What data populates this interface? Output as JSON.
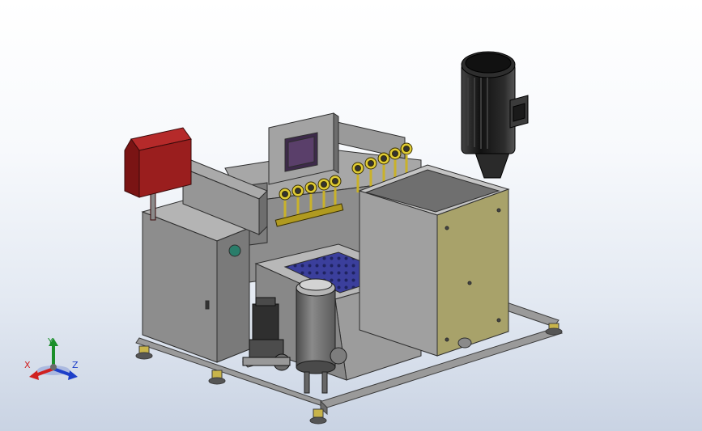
{
  "viewport": {
    "background_top": "#ffffff",
    "background_bottom": "#c9d3e3"
  },
  "triad": {
    "x_label": "X",
    "y_label": "Y",
    "z_label": "Z",
    "x_color": "#d02020",
    "y_color": "#1b8f2a",
    "z_color": "#1d3fc9"
  },
  "model": {
    "colors": {
      "frame": "#9a9a9a",
      "cabinet": "#8b8b8b",
      "hopper_side": "#a8a26a",
      "hopper_front": "#9c9c9c",
      "control_box": "#8e1c1c",
      "motor": "#1e1e1e",
      "tank": "#6e6e6e",
      "mesh": "#3a3f9e",
      "gauges": "#c9b22a",
      "accent": "#2a7d6a"
    },
    "parts": [
      "control-box",
      "electrical-cabinet",
      "center-housing",
      "display-panel",
      "gauge-rack",
      "mesh-tank",
      "filter-vessel",
      "pump",
      "hopper",
      "motor",
      "base-frame"
    ]
  }
}
